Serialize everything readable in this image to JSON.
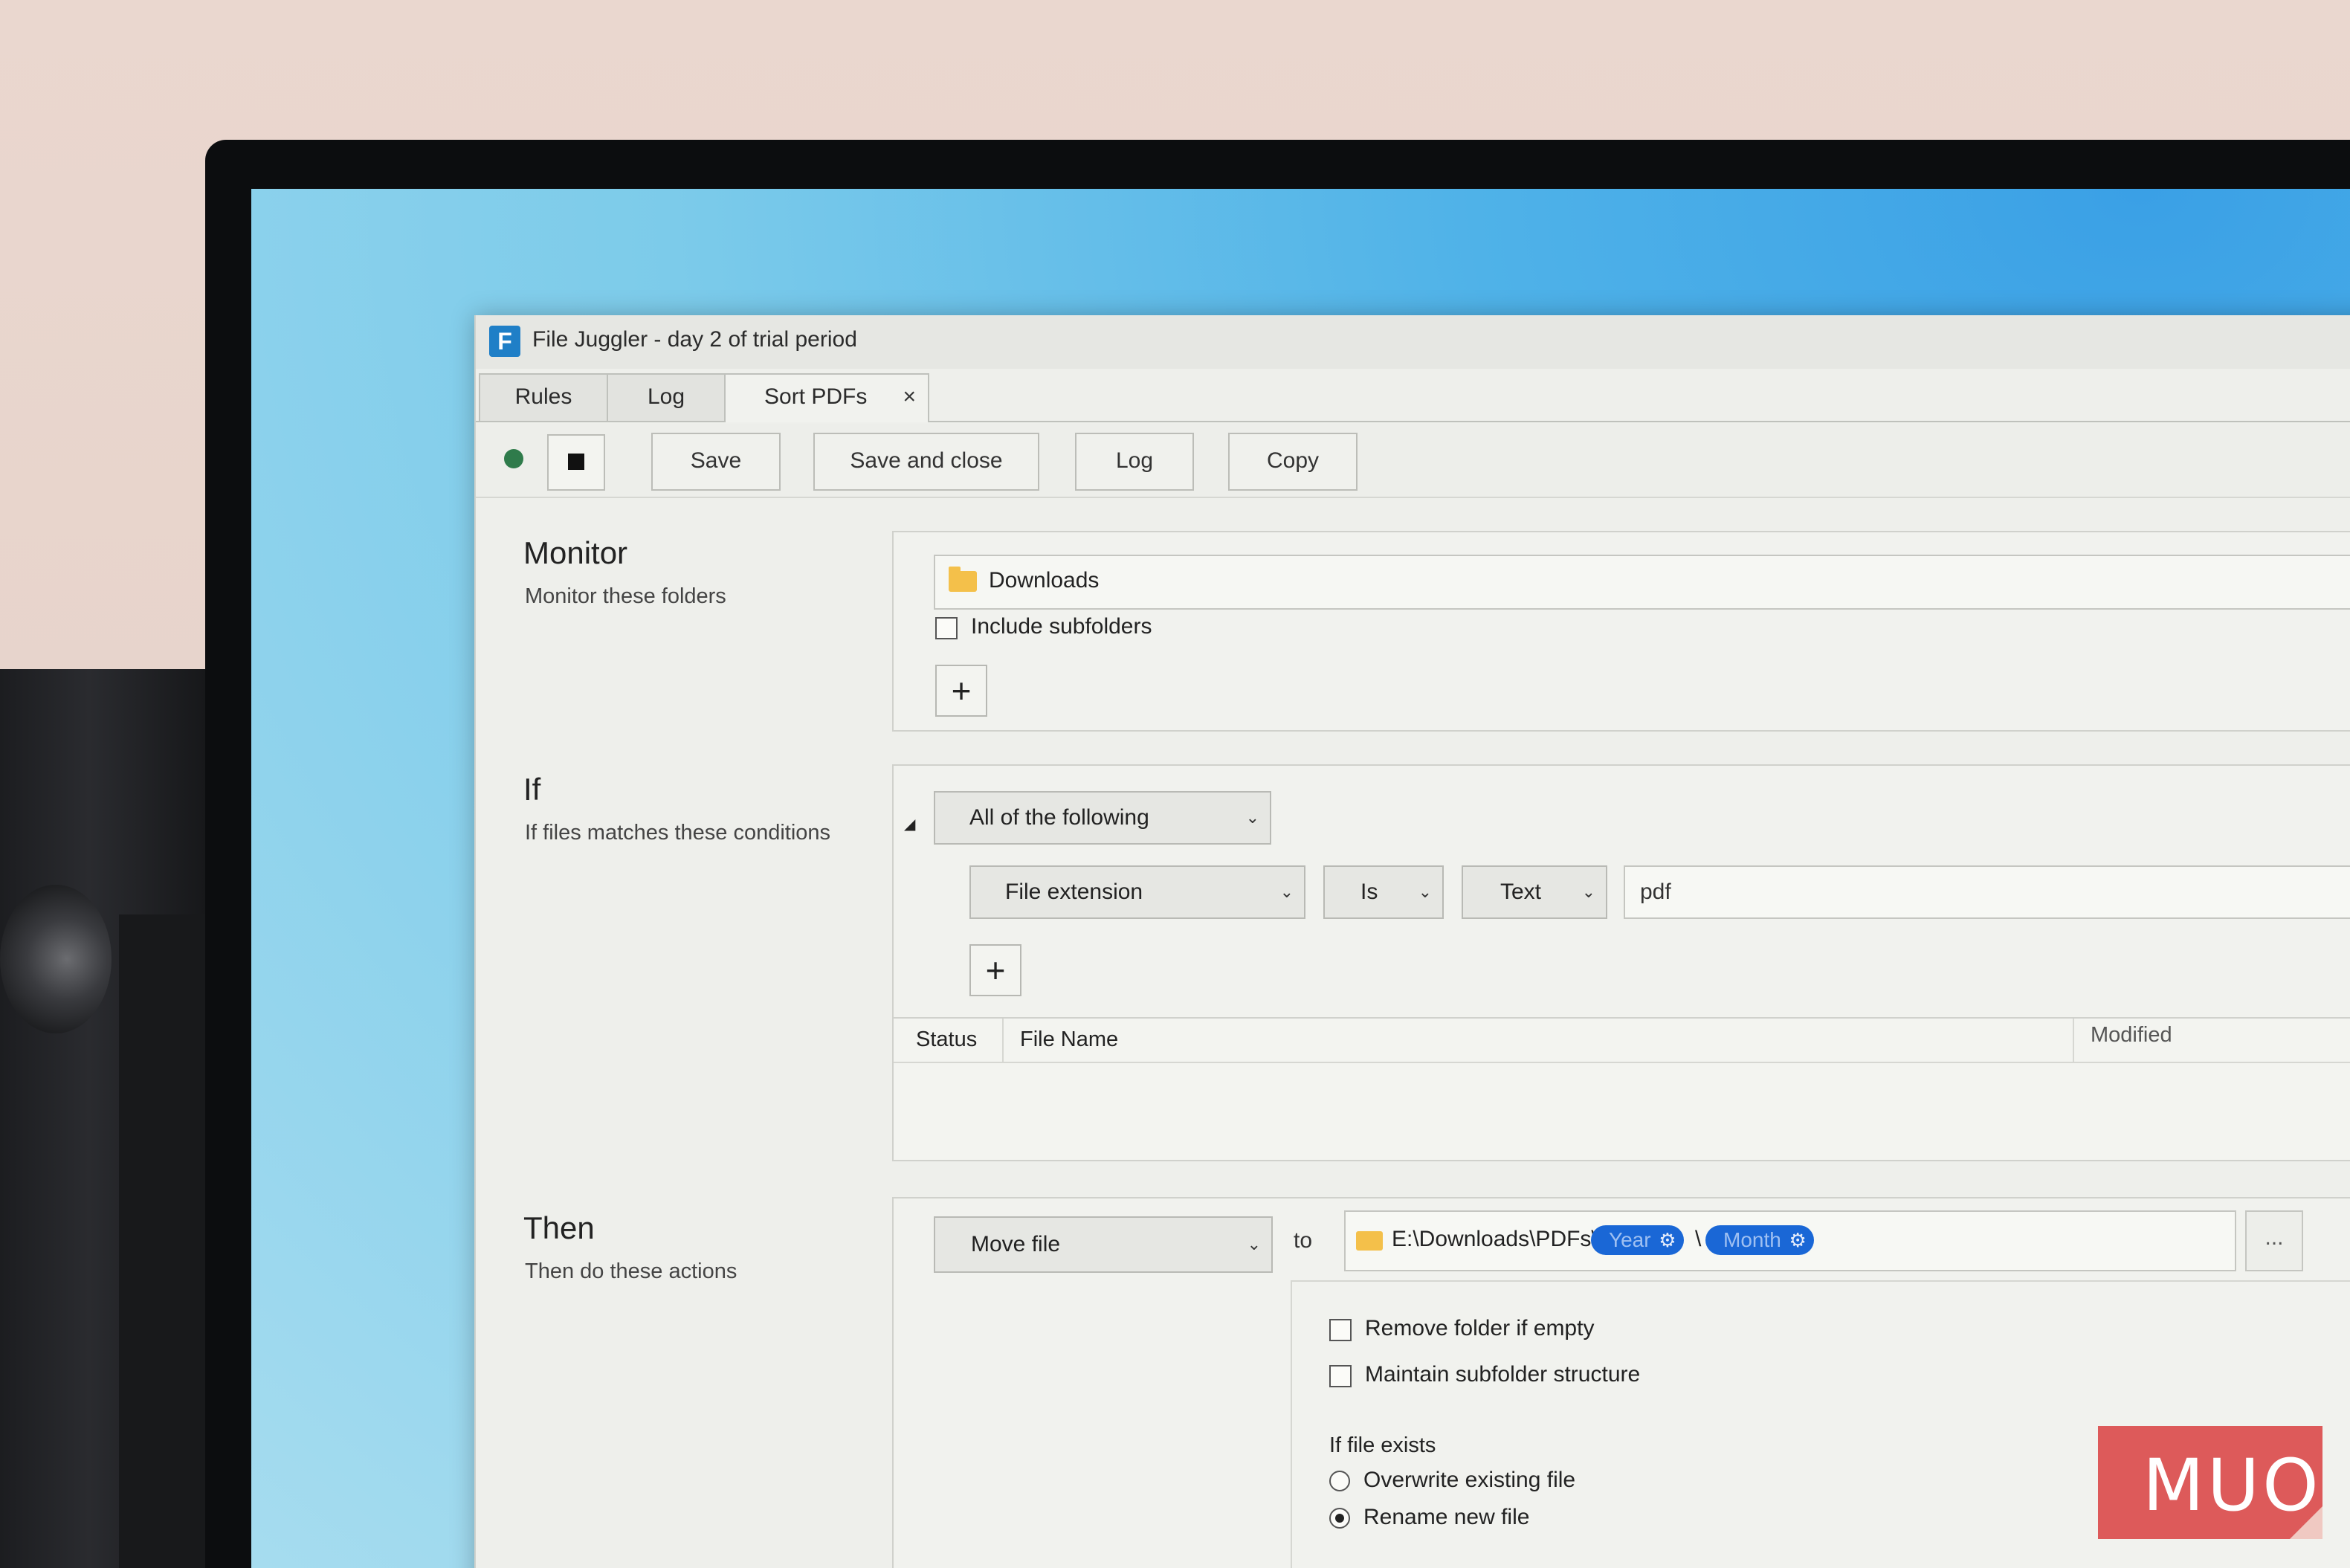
{
  "window": {
    "title": "File Juggler - day 2 of trial period",
    "app_logo": "F"
  },
  "tabs": [
    {
      "label": "Rules"
    },
    {
      "label": "Log"
    },
    {
      "label": "Sort PDFs",
      "close": "×"
    }
  ],
  "toolbar": {
    "save": "Save",
    "save_close": "Save and close",
    "log": "Log",
    "copy": "Copy"
  },
  "monitor": {
    "title": "Monitor",
    "subtitle": "Monitor these folders",
    "folder": "Downloads",
    "include_subfolders": "Include subfolders",
    "add": "+"
  },
  "conditions": {
    "title": "If",
    "subtitle": "If files matches these conditions",
    "group_mode": "All of the following",
    "field": "File extension",
    "operator": "Is",
    "type": "Text",
    "value": "pdf",
    "add": "+"
  },
  "preview": {
    "col_status": "Status",
    "col_file_name": "File Name",
    "col_modified": "Modified"
  },
  "actions": {
    "title": "Then",
    "subtitle": "Then do these actions",
    "action": "Move file",
    "to_label": "to",
    "path_prefix": "E:\\Downloads\\PDFs\\",
    "token_year": "Year",
    "token_month": "Month",
    "path_sep": "\\",
    "browse": "...",
    "remove_folder": "Remove folder if empty",
    "maintain_structure": "Maintain subfolder structure",
    "if_exists_label": "If file exists",
    "overwrite": "Overwrite existing file",
    "rename": "Rename new file"
  },
  "watermark": {
    "text": "MUO"
  },
  "colors": {
    "token": "#1a67d6",
    "run_indicator": "#2f7b4b",
    "watermark": "#dd5a5a"
  }
}
